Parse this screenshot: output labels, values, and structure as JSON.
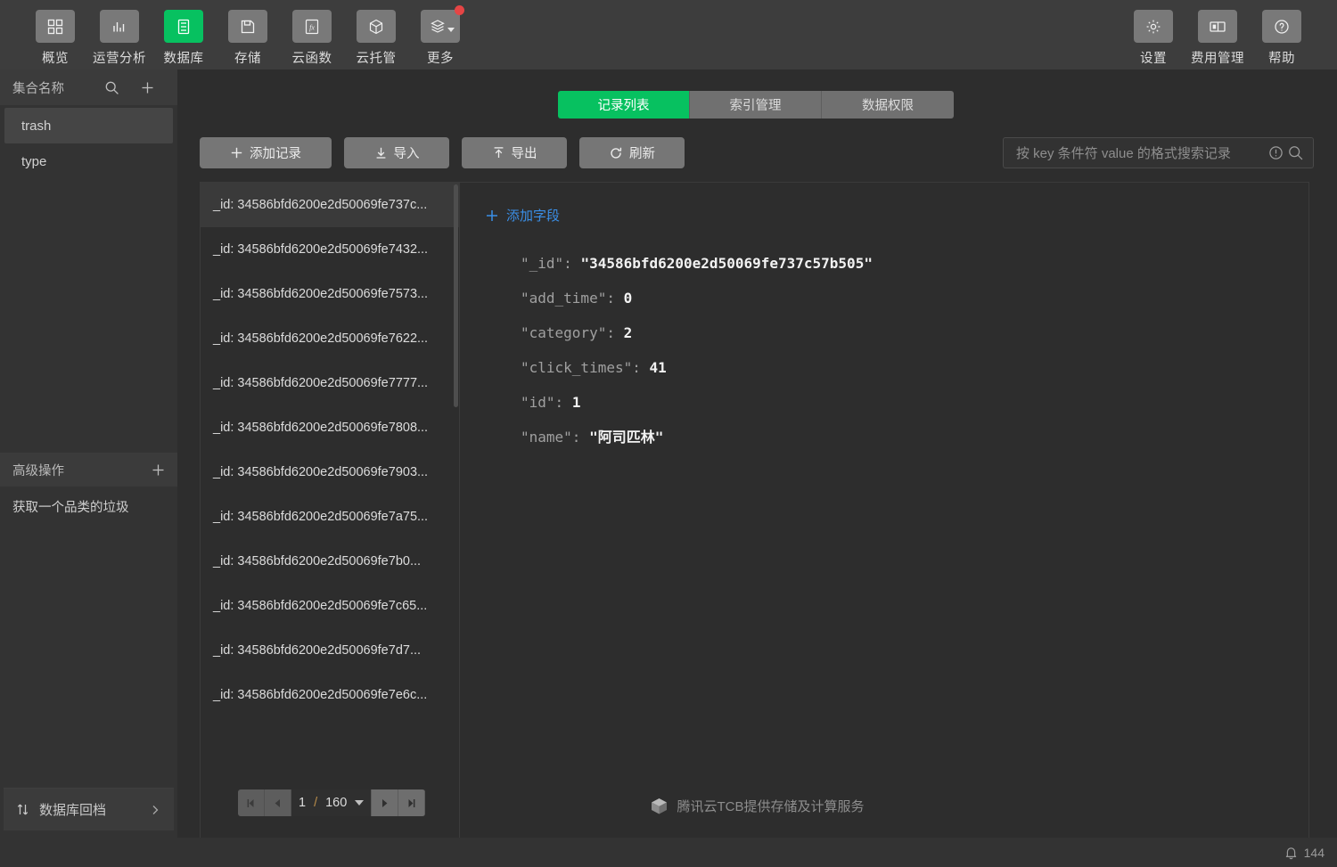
{
  "topnav": {
    "left_items": [
      {
        "label": "概览",
        "icon": "grid-icon",
        "active": false
      },
      {
        "label": "运营分析",
        "icon": "bar-chart-icon",
        "active": false
      },
      {
        "label": "数据库",
        "icon": "database-icon",
        "active": true
      },
      {
        "label": "存储",
        "icon": "save-disk-icon",
        "active": false
      },
      {
        "label": "云函数",
        "icon": "function-icon",
        "active": false
      },
      {
        "label": "云托管",
        "icon": "cube-icon",
        "active": false
      },
      {
        "label": "更多",
        "icon": "layers-icon",
        "active": false,
        "has_caret": true,
        "has_badge": true
      }
    ],
    "right_items": [
      {
        "label": "设置",
        "icon": "gear-icon"
      },
      {
        "label": "费用管理",
        "icon": "billing-panel-icon"
      },
      {
        "label": "帮助",
        "icon": "question-circle-icon"
      }
    ]
  },
  "sidebar": {
    "collections_header": "集合名称",
    "search_icon": "search-icon",
    "add_icon": "plus-icon",
    "collections": [
      {
        "name": "trash",
        "selected": true
      },
      {
        "name": "type",
        "selected": false
      }
    ],
    "advanced_header": "高级操作",
    "advanced_add_icon": "plus-icon",
    "advanced_items": [
      {
        "name": "获取一个品类的垃圾"
      }
    ],
    "rollback": {
      "label": "数据库回档",
      "icon": "sort-updown-icon",
      "chevron": "chevron-right-icon"
    }
  },
  "tabs": [
    {
      "label": "记录列表",
      "active": true
    },
    {
      "label": "索引管理",
      "active": false
    },
    {
      "label": "数据权限",
      "active": false
    }
  ],
  "toolbar": {
    "add_record": "添加记录",
    "import": "导入",
    "export": "导出",
    "refresh": "刷新",
    "add_icon": "plus-icon",
    "import_icon": "download-arrow-icon",
    "export_icon": "upload-arrow-icon",
    "refresh_icon": "refresh-circle-icon"
  },
  "search": {
    "placeholder": "按 key 条件符 value 的格式搜索记录",
    "info_icon": "exclamation-circle-icon",
    "search_icon": "search-icon"
  },
  "record_list": {
    "records": [
      {
        "label": "_id: 34586bfd6200e2d50069fe737c...",
        "selected": true
      },
      {
        "label": "_id: 34586bfd6200e2d50069fe7432...",
        "selected": false
      },
      {
        "label": "_id: 34586bfd6200e2d50069fe7573...",
        "selected": false
      },
      {
        "label": "_id: 34586bfd6200e2d50069fe7622...",
        "selected": false
      },
      {
        "label": "_id: 34586bfd6200e2d50069fe7777...",
        "selected": false
      },
      {
        "label": "_id: 34586bfd6200e2d50069fe7808...",
        "selected": false
      },
      {
        "label": "_id: 34586bfd6200e2d50069fe7903...",
        "selected": false
      },
      {
        "label": "_id: 34586bfd6200e2d50069fe7a75...",
        "selected": false
      },
      {
        "label": "_id: 34586bfd6200e2d50069fe7b0...",
        "selected": false
      },
      {
        "label": "_id: 34586bfd6200e2d50069fe7c65...",
        "selected": false
      },
      {
        "label": "_id: 34586bfd6200e2d50069fe7d7...",
        "selected": false
      },
      {
        "label": "_id: 34586bfd6200e2d50069fe7e6c...",
        "selected": false
      }
    ],
    "pagination": {
      "current_page": "1",
      "separator": "/",
      "total_pages": "160",
      "first_icon": "first-page-icon",
      "prev_icon": "prev-page-icon",
      "next_icon": "next-page-icon",
      "last_icon": "last-page-icon",
      "dropdown_icon": "chevron-down-icon"
    }
  },
  "detail": {
    "add_field_label": "添加字段",
    "add_field_icon": "plus-icon",
    "fields": [
      {
        "key": "\"_id\":",
        "value": "\"34586bfd6200e2d50069fe737c57b505\""
      },
      {
        "key": "\"add_time\":",
        "value": "0"
      },
      {
        "key": "\"category\":",
        "value": "2"
      },
      {
        "key": "\"click_times\":",
        "value": "41"
      },
      {
        "key": "\"id\":",
        "value": "1"
      },
      {
        "key": "\"name\":",
        "value": "\"阿司匹林\""
      }
    ]
  },
  "footer": {
    "text": "腾讯云TCB提供存储及计算服务",
    "icon": "tcb-cube-logo"
  },
  "bottombar": {
    "bell_icon": "bell-icon",
    "notification_count": "144"
  },
  "colors": {
    "accent_green": "#07c160",
    "link_blue": "#3a8ee6",
    "badge_red": "#e54545",
    "nav_bg": "#3d3d3d",
    "sidebar_bg": "#333333",
    "main_bg": "#2d2d2d"
  }
}
